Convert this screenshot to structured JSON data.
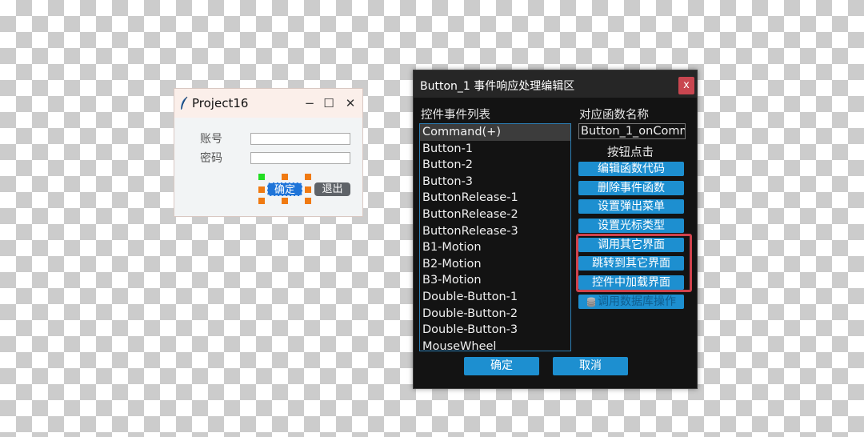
{
  "project_window": {
    "title": "Project16",
    "controls": {
      "minimize": "−",
      "maximize": "☐",
      "close": "✕"
    },
    "fields": [
      {
        "label": "账号",
        "value": ""
      },
      {
        "label": "密码",
        "value": ""
      }
    ],
    "confirm_label": "确定",
    "exit_label": "退出"
  },
  "dialog": {
    "title": "Button_1 事件响应处理编辑区",
    "close_label": "x",
    "events_label": "控件事件列表",
    "events": [
      "Command(+)",
      "Button-1",
      "Button-2",
      "Button-3",
      "ButtonRelease-1",
      "ButtonRelease-2",
      "ButtonRelease-3",
      "B1-Motion",
      "B2-Motion",
      "B3-Motion",
      "Double-Button-1",
      "Double-Button-2",
      "Double-Button-3",
      "MouseWheel"
    ],
    "selected_event_index": 0,
    "func_name_label": "对应函数名称",
    "func_name_value": "Button_1_onComm",
    "button_click_label": "按钮点击",
    "actions": [
      "编辑函数代码",
      "删除事件函数",
      "设置弹出菜单",
      "设置光标类型",
      "调用其它界面",
      "跳转到其它界面",
      "控件中加载界面",
      "调用数据库操作"
    ],
    "ok_label": "确定",
    "cancel_label": "取消"
  },
  "colors": {
    "accent_blue": "#1d8fd0",
    "dialog_bg": "#131313",
    "highlight_red": "#d0424c",
    "handle_orange": "#f07a12",
    "handle_green": "#22dd22"
  }
}
